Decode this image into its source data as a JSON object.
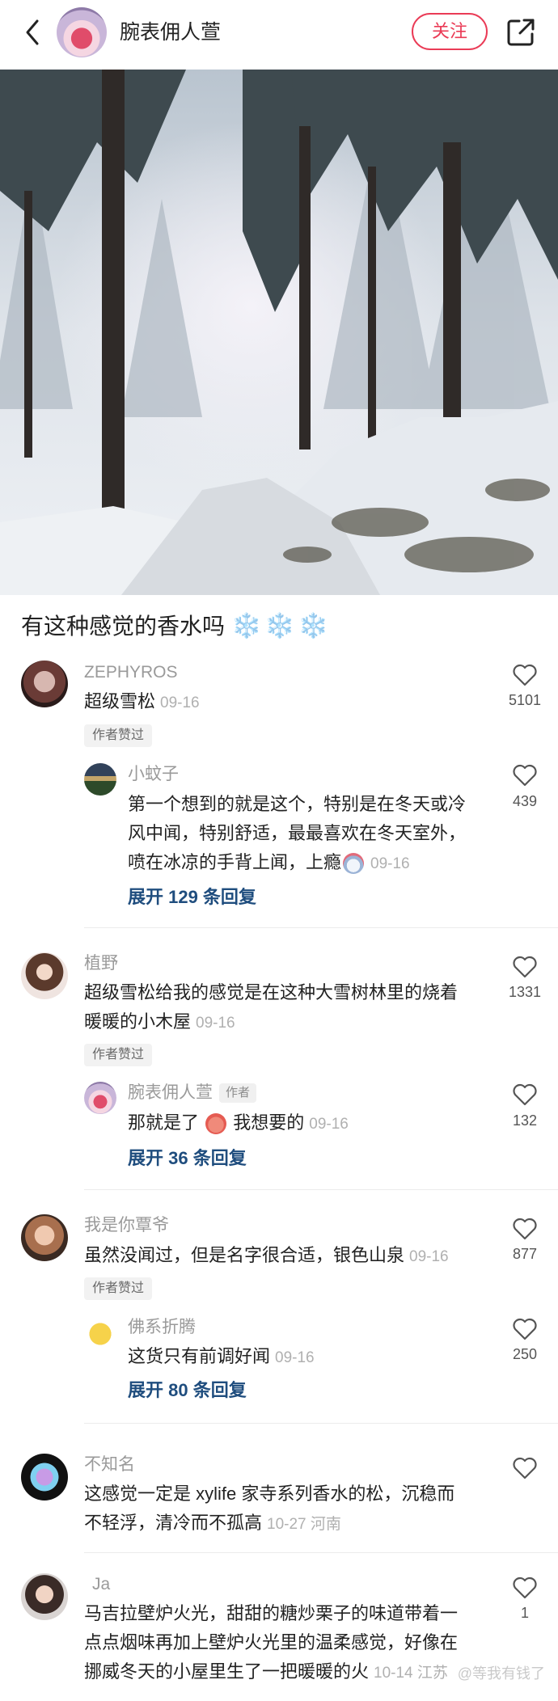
{
  "header": {
    "account_name": "腕表佣人萱",
    "follow_label": "关注",
    "back_icon": "back-arrow-icon",
    "share_icon": "share-icon"
  },
  "post": {
    "title": "有这种感觉的香水吗",
    "title_emoji": "❄️❄️❄️"
  },
  "comments": [
    {
      "user": "ZEPHYROS",
      "text": "超级雪松",
      "date": "09-16",
      "likes": "5101",
      "tag": "作者赞过",
      "reply": {
        "user": "小蚊子",
        "text_line1": "第一个想到的就是这个，特别是在冬天或冷",
        "text_line2": "风中闻，特别舒适，最最喜欢在冬天室外，",
        "text_line3": "喷在冰凉的手背上闻，上瘾",
        "date": "09-16",
        "likes": "439"
      },
      "expand": "展开 129 条回复"
    },
    {
      "user": "植野",
      "text_line1": "超级雪松给我的感觉是在这种大雪树林里的烧着",
      "text_line2": "暖暖的小木屋",
      "date": "09-16",
      "likes": "1331",
      "tag": "作者赞过",
      "reply": {
        "user": "腕表佣人萱",
        "badge": "作者",
        "text_a": "那就是了",
        "text_b": "我想要的",
        "date": "09-16",
        "likes": "132"
      },
      "expand": "展开 36 条回复"
    },
    {
      "user": "我是你覃爷",
      "text": "虽然没闻过，但是名字很合适，银色山泉",
      "date": "09-16",
      "likes": "877",
      "tag": "作者赞过",
      "reply": {
        "user": "佛系折腾",
        "text": "这货只有前调好闻",
        "date": "09-16",
        "likes": "250"
      },
      "expand": "展开 80 条回复"
    },
    {
      "user": "不知名",
      "text_line1": "这感觉一定是 xylife 家寺系列香水的松，沉稳而",
      "text_line2": "不轻浮，清冷而不孤高",
      "date": "10-27 河南",
      "likes": ""
    },
    {
      "user": "Ja",
      "text_line1": "马吉拉壁炉火光，甜甜的糖炒栗子的味道带着一",
      "text_line2": "点点烟味再加上壁炉火光里的温柔感觉，好像在",
      "text_line3": "挪威冬天的小屋里生了一把暖暖的火",
      "date": "10-14 江苏",
      "likes": "1"
    }
  ],
  "watermark": "@等我有钱了",
  "colors": {
    "accent": "#ea3b56",
    "link": "#1f4d7e",
    "muted": "#9a9a9a"
  }
}
